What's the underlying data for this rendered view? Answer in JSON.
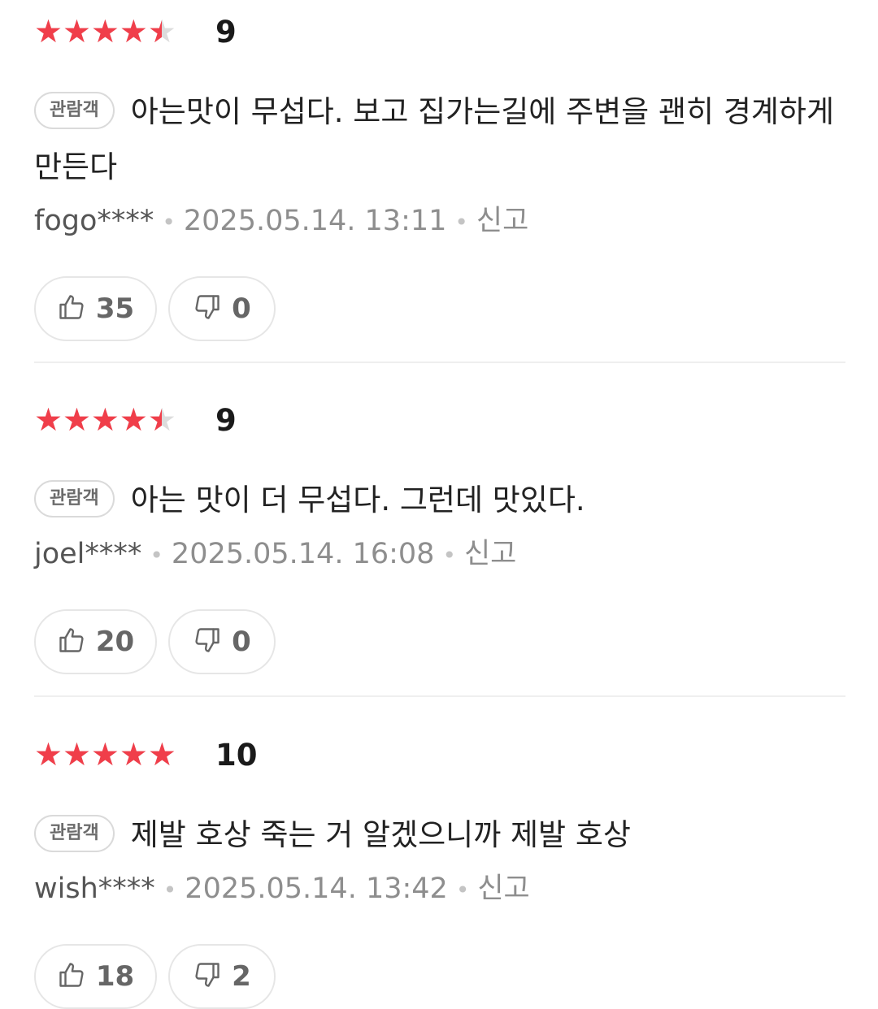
{
  "reviews": [
    {
      "rating": 4.5,
      "stars": "★★★★★",
      "score": "9",
      "badge": "관람객",
      "text": "아는맛이 무섭다. 보고 집가는길에 주변을 괜히 경계하게 만든다",
      "user": "fogo****",
      "date": "2025.05.14. 13:11",
      "report": "신고",
      "likes": "35",
      "dislikes": "0"
    },
    {
      "rating": 4.5,
      "stars": "★★★★★",
      "score": "9",
      "badge": "관람객",
      "text": "아는 맛이 더 무섭다. 그런데 맛있다.",
      "user": "joel****",
      "date": "2025.05.14. 16:08",
      "report": "신고",
      "likes": "20",
      "dislikes": "0"
    },
    {
      "rating": 5,
      "stars": "★★★★★",
      "score": "10",
      "badge": "관람객",
      "text": "제발 호상 죽는 거 알겠으니까 제발 호상",
      "user": "wish****",
      "date": "2025.05.14. 13:42",
      "report": "신고",
      "likes": "18",
      "dislikes": "2"
    }
  ],
  "separator": "•",
  "icons": {
    "like": "thumbs-up-icon",
    "dislike": "thumbs-down-icon"
  },
  "colors": {
    "star": "#f03e4a",
    "star_empty": "#dcdcdc",
    "meta": "#8e8e8e"
  }
}
